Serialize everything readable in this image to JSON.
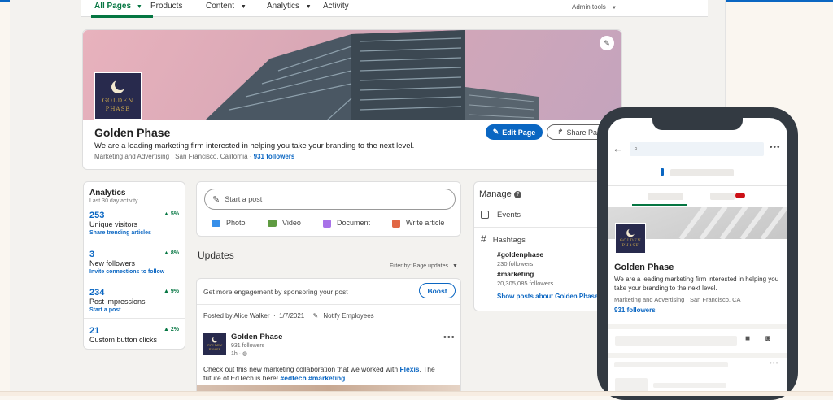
{
  "nav": {
    "all_pages": "All Pages",
    "products": "Products",
    "content": "Content",
    "analytics": "Analytics",
    "activity": "Activity",
    "admin_tools": "Admin tools"
  },
  "profile": {
    "name": "Golden Phase",
    "logo_text": "GOLDEN PHASE",
    "tagline": "We are a leading marketing firm interested in helping you take your branding to the next level.",
    "meta": "Marketing and Advertising · San Francisco, California ·",
    "followers": "931 followers",
    "edit_button": "Edit Page",
    "share_button": "Share Pag"
  },
  "analytics": {
    "title": "Analytics",
    "subtitle": "Last 30 day activity",
    "stats": [
      {
        "value": "253",
        "change": "5%",
        "label": "Unique visitors",
        "link": "Share trending articles"
      },
      {
        "value": "3",
        "change": "8%",
        "label": "New followers",
        "link": "Invite connections to follow"
      },
      {
        "value": "234",
        "change": "9%",
        "label": "Post impressions",
        "link": "Start a post"
      },
      {
        "value": "21",
        "change": "2%",
        "label": "Custom button clicks",
        "link": ""
      }
    ]
  },
  "composer": {
    "placeholder": "Start a post",
    "photo": "Photo",
    "video": "Video",
    "document": "Document",
    "article": "Write article"
  },
  "updates": {
    "title": "Updates",
    "filter": "Filter by: Page updates",
    "sponsor_text": "Get more engagement by sponsoring your post",
    "boost": "Boost",
    "posted_by": "Posted by Alice Walker",
    "date": "1/7/2021",
    "notify": "Notify Employees",
    "post_author": "Golden Phase",
    "post_followers": "931 followers",
    "post_time": "1h ·",
    "post_body_1": "Check out this new marketing collaboration that we worked with",
    "post_link": "Flexis",
    "post_body_1_end": ". The",
    "post_body_2": "future of EdTech is here!",
    "post_tags": "#edtech #marketing"
  },
  "manage": {
    "title": "Manage",
    "events": "Events",
    "hashtags": "Hashtags",
    "tags": [
      {
        "tag": "#goldenphase",
        "followers": "230 followers"
      },
      {
        "tag": "#marketing",
        "followers": "20,305,085 followers"
      }
    ],
    "show_posts": "Show posts about Golden Phase"
  },
  "mobile": {
    "name": "Golden Phase",
    "tagline": "We are a leading marketing firm interested in helping you take your branding to the next level.",
    "meta": "Marketing and Advertising · San Francisco, CA",
    "followers": "931 followers",
    "logo_text": "GOLDEN PHASE"
  },
  "colors": {
    "accent": "#0a66c2",
    "green": "#057642",
    "logo_bg": "#282a4d",
    "logo_gold": "#c9a64b"
  }
}
